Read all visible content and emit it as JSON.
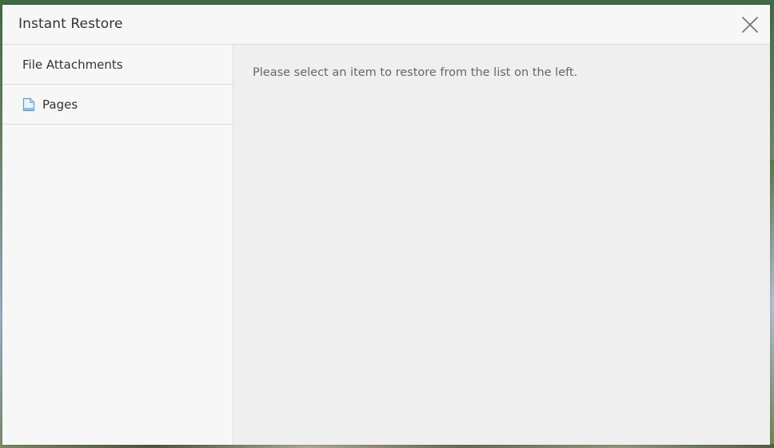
{
  "dialog": {
    "title": "Instant Restore",
    "close_icon": "close-icon"
  },
  "sidebar": {
    "items": [
      {
        "label": "File Attachments",
        "icon": null
      },
      {
        "label": "Pages",
        "icon": "page-document-icon"
      }
    ]
  },
  "main": {
    "message": "Please select an item to restore from the list on the left."
  },
  "colors": {
    "dialog_bg": "#f7f7f7",
    "main_bg": "#efefef",
    "border": "#dcdcdc",
    "title_text": "#333333",
    "message_text": "#666666",
    "icon_blue": "#5a9fd4"
  }
}
